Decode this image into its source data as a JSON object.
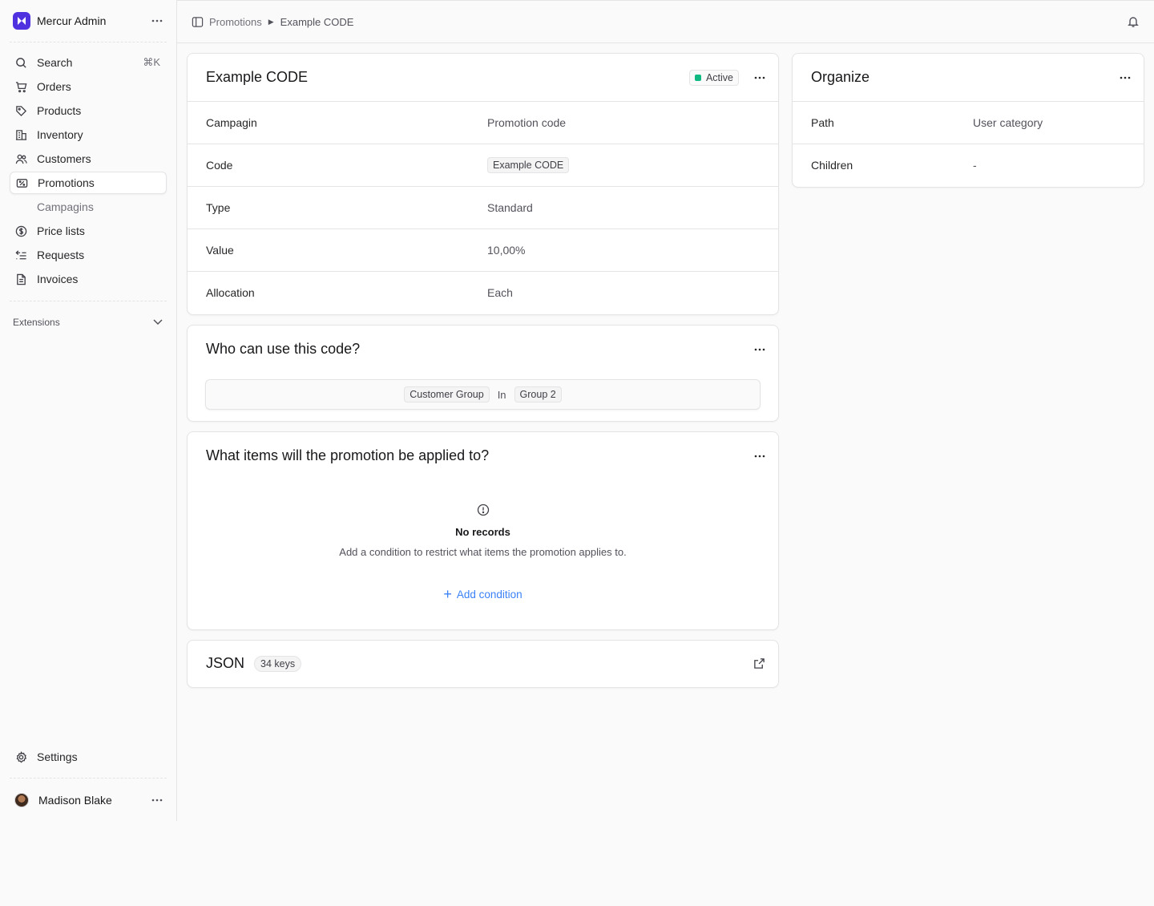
{
  "app": {
    "store_name": "Mercur Admin",
    "accent": "#4f31e0"
  },
  "sidebar": {
    "search": {
      "label": "Search",
      "shortcut": "⌘K"
    },
    "items": [
      {
        "label": "Orders",
        "icon": "cart-icon"
      },
      {
        "label": "Products",
        "icon": "tag-icon"
      },
      {
        "label": "Inventory",
        "icon": "buildings-icon"
      },
      {
        "label": "Customers",
        "icon": "users-icon"
      },
      {
        "label": "Promotions",
        "icon": "receipt-percent-icon",
        "active": true
      },
      {
        "label": "Campagins",
        "sub": true
      },
      {
        "label": "Price lists",
        "icon": "currency-dollar-icon"
      },
      {
        "label": "Requests",
        "icon": "requests-icon"
      },
      {
        "label": "Invoices",
        "icon": "document-icon"
      }
    ],
    "extensions_label": "Extensions",
    "settings_label": "Settings",
    "user_name": "Madison Blake"
  },
  "breadcrumb": {
    "parent": "Promotions",
    "current": "Example CODE"
  },
  "promotion": {
    "title": "Example CODE",
    "status": "Active",
    "status_color": "#10b981",
    "rows": [
      {
        "label": "Campagin",
        "value": "Promotion code"
      },
      {
        "label": "Code",
        "value": "Example CODE"
      },
      {
        "label": "Type",
        "value": "Standard"
      },
      {
        "label": "Value",
        "value": "10,00%"
      },
      {
        "label": "Allocation",
        "value": "Each"
      }
    ]
  },
  "who": {
    "title": "Who can use this code?",
    "attribute": "Customer Group",
    "operator": "In",
    "value": "Group 2"
  },
  "items": {
    "title": "What items will the promotion be applied to?",
    "empty_title": "No records",
    "empty_desc": "Add a condition to restrict what items the promotion applies to.",
    "action": "Add condition",
    "action_color": "#3b82f6"
  },
  "json": {
    "title": "JSON",
    "keys": "34 keys"
  },
  "organize": {
    "title": "Organize",
    "rows": [
      {
        "label": "Path",
        "value": "User category"
      },
      {
        "label": "Children",
        "value": "-"
      }
    ]
  }
}
